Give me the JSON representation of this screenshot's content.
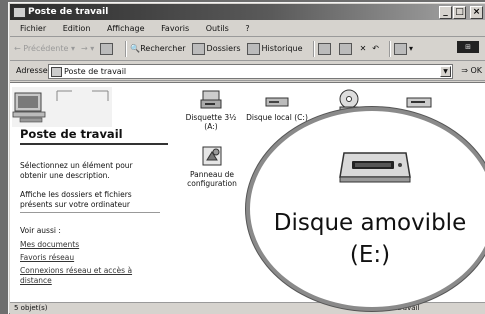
{
  "window": {
    "title": "Poste de travail"
  },
  "menu": [
    "Fichier",
    "Edition",
    "Affichage",
    "Favoris",
    "Outils",
    "?"
  ],
  "toolbar": {
    "back": "Précédente",
    "search": "Rechercher",
    "folders": "Dossiers",
    "history": "Historique"
  },
  "address": {
    "label": "Adresse",
    "value": "Poste de travail",
    "go": "OK"
  },
  "left_pane": {
    "title": "Poste de travail",
    "select_desc": "Sélectionnez un élément pour obtenir une description.",
    "show_info": "Affiche les dossiers et fichiers présents sur votre ordinateur",
    "see_also": "Voir aussi :",
    "links": [
      "Mes documents",
      "Favoris réseau",
      "Connexions réseau et accès à distance"
    ]
  },
  "icons": {
    "floppy": "Disquette 3½ (A:)",
    "local": "Disque local (C:)",
    "control_panel": "Panneau de configuration"
  },
  "zoom": {
    "label_line1": "Disque amovible",
    "label_line2": "(E:)"
  },
  "status": {
    "left": "5 objet(s)",
    "right": "Poste de travail"
  }
}
